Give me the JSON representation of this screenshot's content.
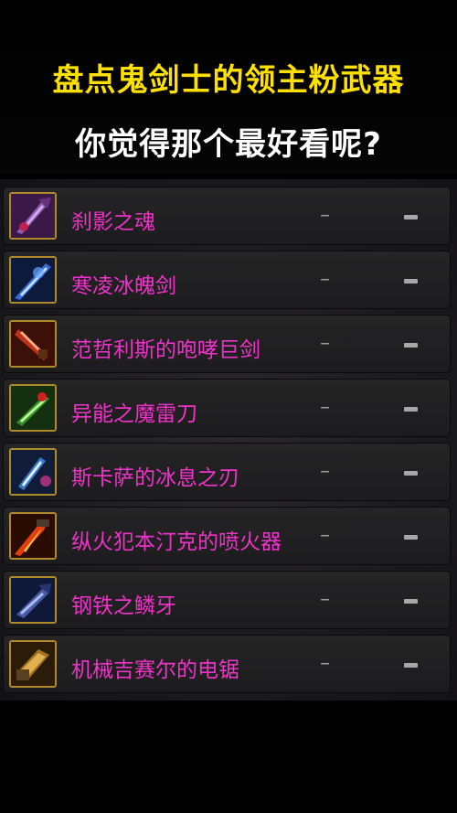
{
  "header": {
    "title_line1": "盘点鬼剑士的领主粉武器",
    "title_line2": "你觉得那个最好看呢?"
  },
  "weapons": [
    {
      "name": "刹影之魂",
      "col1": "–",
      "icon": "dark-blade-icon"
    },
    {
      "name": "寒凌冰魄剑",
      "col1": "–",
      "icon": "ice-sword-icon"
    },
    {
      "name": "范哲利斯的咆哮巨剑",
      "col1": "–",
      "icon": "great-sword-icon"
    },
    {
      "name": "异能之魔雷刀",
      "col1": "–",
      "icon": "lightning-blade-icon"
    },
    {
      "name": "斯卡萨的冰息之刃",
      "col1": "–",
      "icon": "frost-blade-icon"
    },
    {
      "name": "纵火犯本汀克的喷火器",
      "col1": "–",
      "icon": "flamethrower-icon"
    },
    {
      "name": "钢铁之鳞牙",
      "col1": "–",
      "icon": "steel-fang-icon"
    },
    {
      "name": "机械吉赛尔的电锯",
      "col1": "–",
      "icon": "chainsaw-icon"
    }
  ],
  "colors": {
    "title_yellow": "#ffe000",
    "name_pink": "#ee33c8",
    "icon_border": "#b08a2a"
  }
}
